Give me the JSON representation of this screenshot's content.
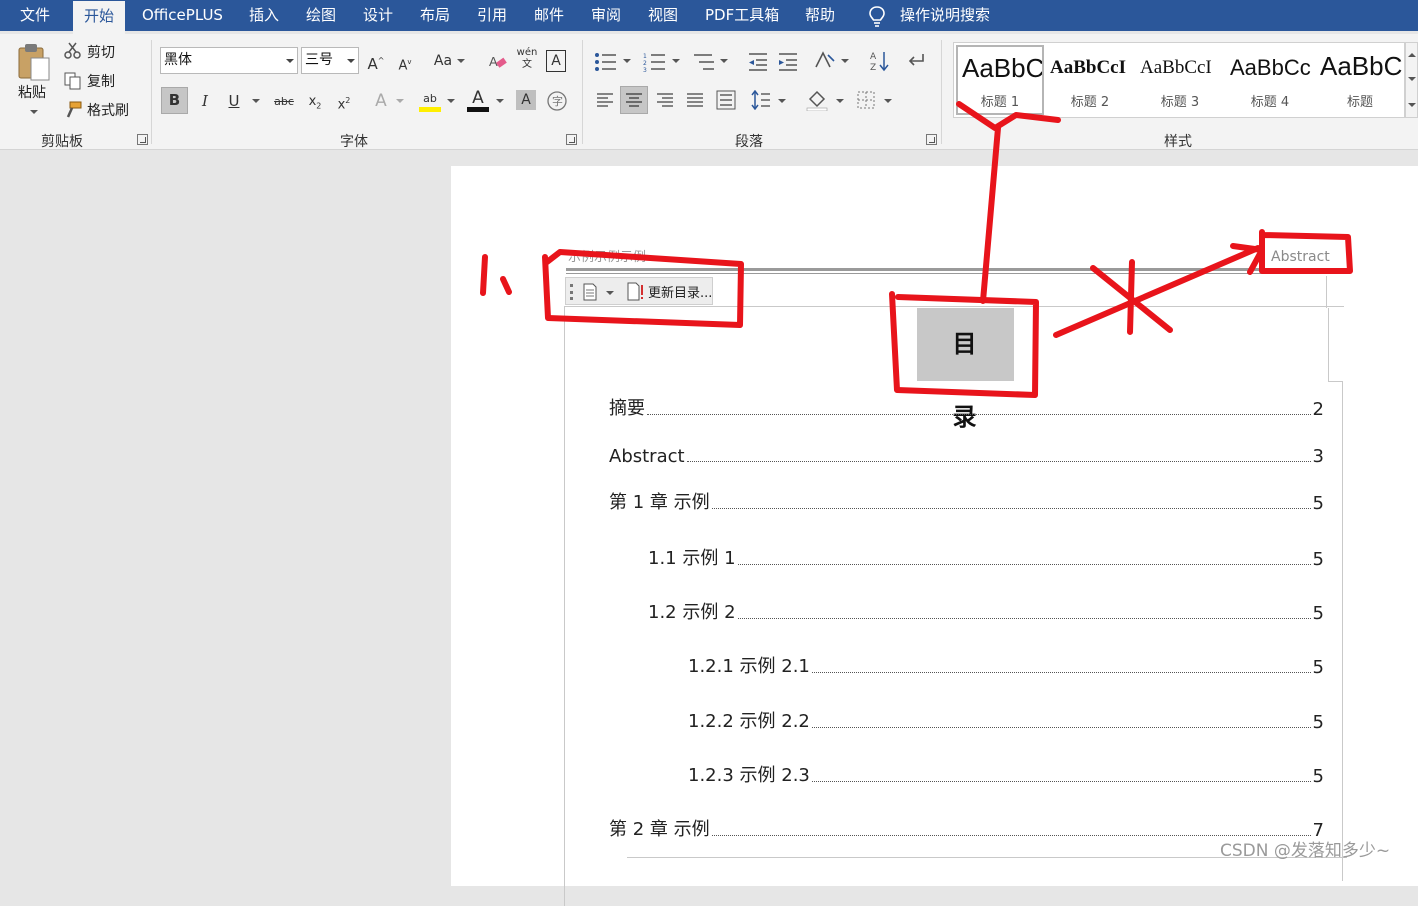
{
  "menu": {
    "tabs": [
      "文件",
      "开始",
      "OfficePLUS",
      "插入",
      "绘图",
      "设计",
      "布局",
      "引用",
      "邮件",
      "审阅",
      "视图",
      "PDF工具箱",
      "帮助"
    ],
    "active_tab": "开始",
    "tell_me": "操作说明搜索"
  },
  "ribbon": {
    "clipboard": {
      "paste": "粘贴",
      "cut": "剪切",
      "copy": "复制",
      "format_painter": "格式刷",
      "label": "剪贴板"
    },
    "font": {
      "family": "黑体",
      "size": "三号",
      "label": "字体",
      "change_case": "Aa",
      "strikethrough": "abc",
      "pinyin": "wén"
    },
    "paragraph": {
      "label": "段落"
    },
    "styles": {
      "label": "样式",
      "items": [
        {
          "sample": "AaBbC",
          "name": "标题 1"
        },
        {
          "sample": "AaBbCcI",
          "name": "标题 2"
        },
        {
          "sample": "AaBbCcI",
          "name": "标题 3"
        },
        {
          "sample": "AaBbCc",
          "name": "标题 4"
        },
        {
          "sample": "AaBbC",
          "name": "标题"
        }
      ]
    }
  },
  "document": {
    "header_left": "示例示例示例",
    "header_right": "Abstract",
    "toc_toolbar_update": "更新目录...",
    "toc_title": "目录",
    "toc": [
      {
        "label": "摘要",
        "page": "2",
        "level": 1
      },
      {
        "label": "Abstract",
        "page": "3",
        "level": 1
      },
      {
        "label": "第 1 章 示例",
        "page": "5",
        "level": 1
      },
      {
        "label": "1.1 示例 1",
        "page": "5",
        "level": 2
      },
      {
        "label": "1.2 示例 2",
        "page": "5",
        "level": 2
      },
      {
        "label": "1.2.1 示例 2.1",
        "page": "5",
        "level": 3
      },
      {
        "label": "1.2.2 示例 2.2",
        "page": "5",
        "level": 3
      },
      {
        "label": "1.2.3 示例 2.3",
        "page": "5",
        "level": 3
      },
      {
        "label": "第 2 章 示例",
        "page": "7",
        "level": 1
      }
    ]
  },
  "annotation": {
    "marker": "1.",
    "color": "#e8141b"
  },
  "watermark": "CSDN @发落知多少~"
}
